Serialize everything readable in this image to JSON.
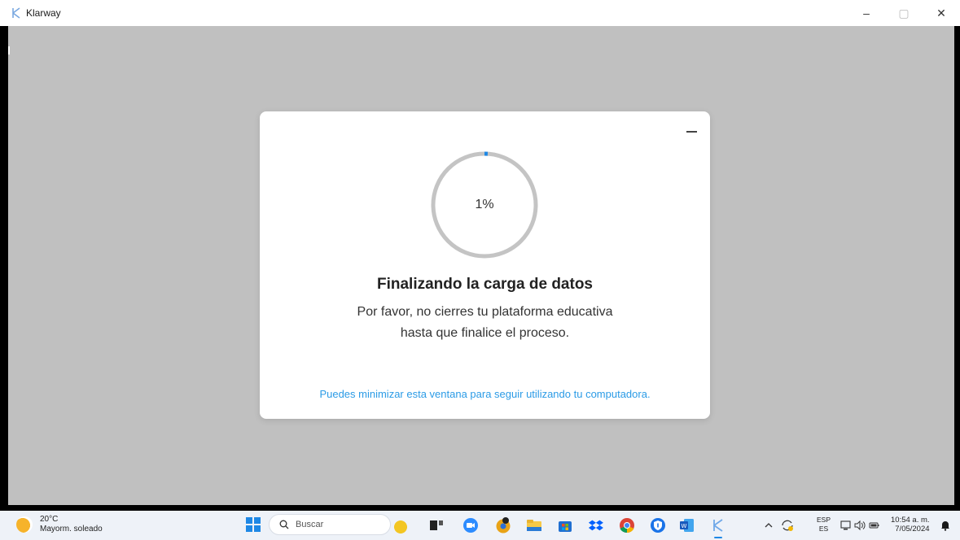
{
  "window": {
    "title": "Klarway",
    "controls": {
      "minimize": "–",
      "maximize": "▢",
      "close": "✕"
    }
  },
  "modal": {
    "minimize_label": "–",
    "progress": {
      "percent": 1,
      "label": "1%"
    },
    "title": "Finalizando la carga de datos",
    "message_line1": "Por favor, no cierres tu plataforma educativa",
    "message_line2": "hasta que finalice el proceso.",
    "hint": "Puedes minimizar esta ventana para seguir utilizando tu computadora."
  },
  "colors": {
    "accent": "#2b9be6",
    "progress_track": "#c4c4c4",
    "progress_fill": "#1e88e5",
    "backdrop": "#c0c0c0"
  },
  "taskbar": {
    "weather": {
      "temp": "20°C",
      "desc": "Mayorm. soleado"
    },
    "search_placeholder": "Buscar",
    "apps": [
      "duck-app-icon",
      "task-view-icon",
      "zoom-icon",
      "chrome-canary-icon",
      "file-explorer-icon",
      "store-icon",
      "dropbox-icon",
      "chrome-icon",
      "shield-app-icon",
      "word-icon",
      "klarway-icon"
    ],
    "tray": {
      "lang_top": "ESP",
      "lang_bottom": "ES",
      "time": "10:54 a. m.",
      "date": "7/05/2024"
    }
  }
}
